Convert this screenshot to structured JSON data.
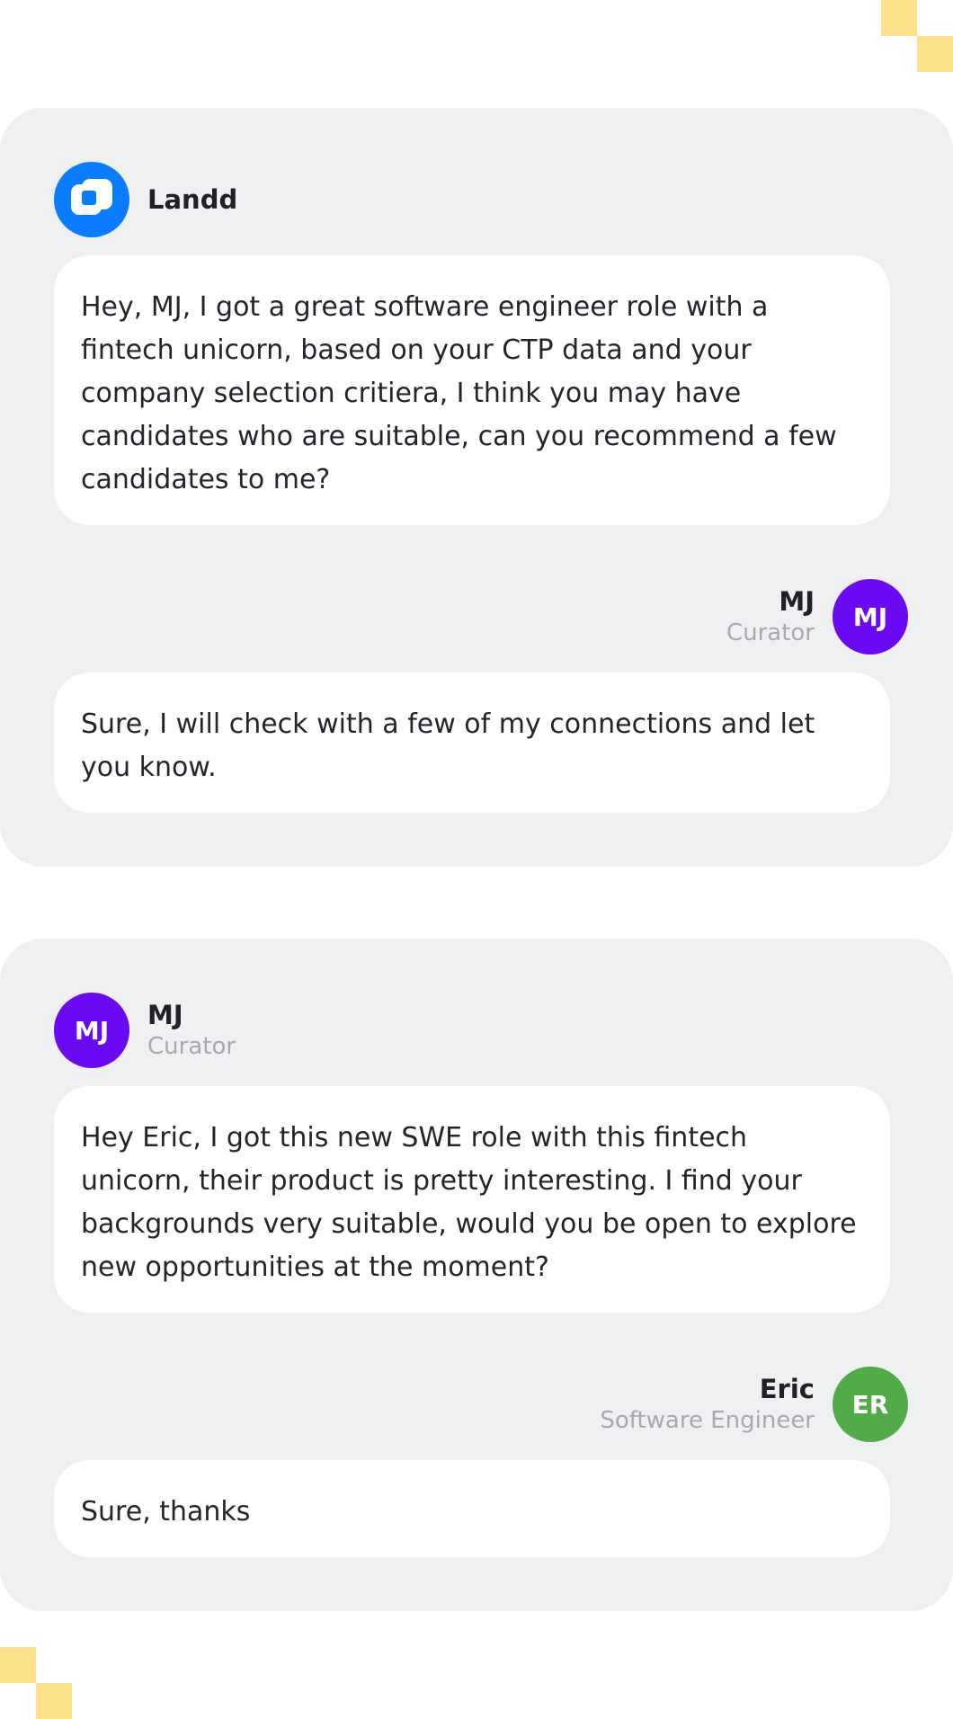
{
  "thread1": {
    "sender": {
      "name": "Landd",
      "logo_icon": "landd-logo-icon"
    },
    "message": "Hey, MJ, I got a great software engineer role with a fintech unicorn, based on your CTP data and your company selection critiera, I think you may have candidates who are suitable, can you recommend a few candidates to me?",
    "reply_author": {
      "name": "MJ",
      "role": "Curator",
      "initials": "MJ"
    },
    "reply": "Sure, I will check with a few of my connections and let you know."
  },
  "thread2": {
    "sender": {
      "name": "MJ",
      "role": "Curator",
      "initials": "MJ"
    },
    "message": "Hey Eric, I got this new SWE role with this fintech unicorn, their product is pretty interesting. I find your backgrounds very suitable, would you be open to explore new opportunities at the moment?",
    "reply_author": {
      "name": "Eric",
      "role": "Software Engineer",
      "initials": "ER"
    },
    "reply": "Sure, thanks"
  },
  "colors": {
    "landd_blue": "#0a7cff",
    "curator_purple": "#6a0af2",
    "engineer_green": "#52aa49",
    "decoration_yellow": "#fde28a"
  }
}
